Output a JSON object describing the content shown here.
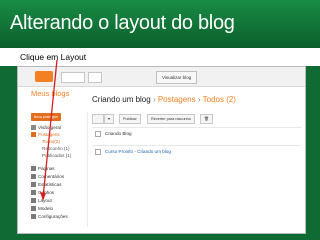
{
  "slide": {
    "title": "Alterando o layout do blog",
    "caption": "Clique em Layout"
  },
  "app": {
    "view_blog_button": "Visualizar blog",
    "sidebar_heading": "Meus blogs",
    "new_post_button": "Nova postagem",
    "nav": [
      {
        "label": "Visão geral",
        "icon": "home-icon",
        "active": false
      },
      {
        "label": "Postagens",
        "icon": "posts-icon",
        "active": true
      },
      {
        "label": "Todos(2)",
        "sub": true,
        "active": true
      },
      {
        "label": "Rascunho (1)",
        "sub": true,
        "active": false
      },
      {
        "label": "Publicados (1)",
        "sub": true,
        "active": false
      },
      {
        "label": "Páginas",
        "icon": "pages-icon"
      },
      {
        "label": "Comentários",
        "icon": "comments-icon"
      },
      {
        "label": "Estatísticas",
        "icon": "stats-icon"
      },
      {
        "label": "Ganhos",
        "icon": "earnings-icon"
      },
      {
        "label": "Layout",
        "icon": "layout-icon"
      },
      {
        "label": "Modelo",
        "icon": "template-icon"
      },
      {
        "label": "Configurações",
        "icon": "settings-icon"
      }
    ],
    "main_title": {
      "prefix": "Criando um blog",
      "section": "Postagens",
      "filter": "Todos (2)"
    },
    "toolbar": {
      "publish": "Publicar",
      "revert": "Reverter para rascunho"
    },
    "posts": [
      {
        "title": "Criando Blog",
        "blue": false
      },
      {
        "title": "Curso Proinfo - Criando um blog",
        "blue": true
      }
    ],
    "colors": {
      "accent": "#f48024",
      "arrow": "#d32020"
    }
  }
}
